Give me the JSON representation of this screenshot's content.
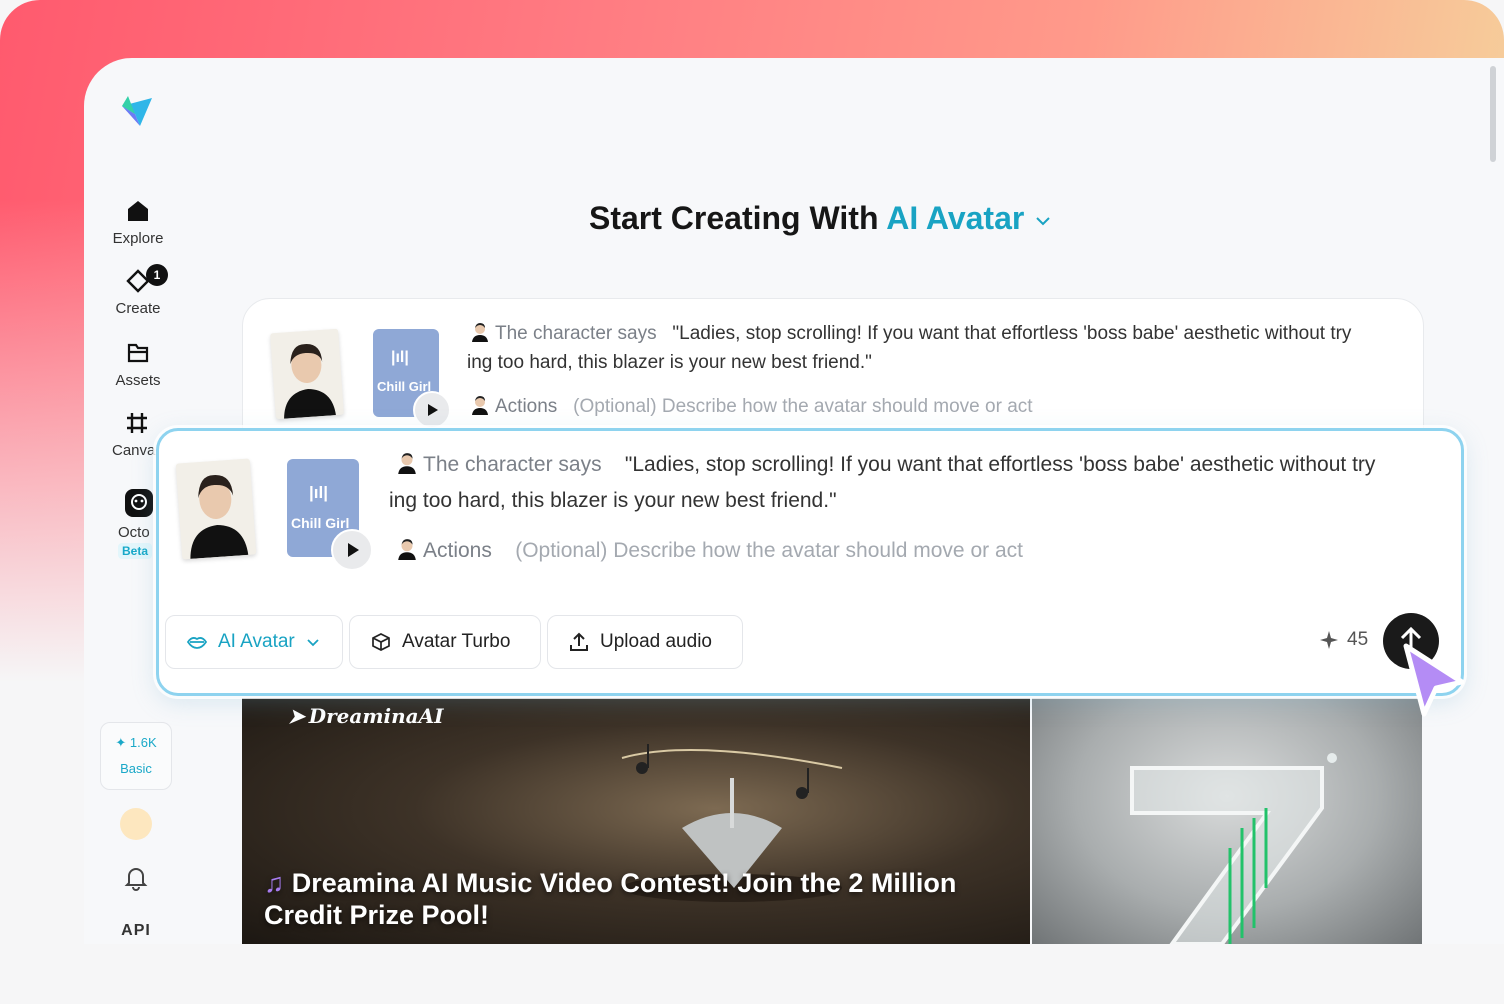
{
  "sidebar": {
    "items": [
      {
        "label": "Explore",
        "icon": "home-icon"
      },
      {
        "label": "Create",
        "icon": "create-icon",
        "badge": "1"
      },
      {
        "label": "Assets",
        "icon": "folder-icon"
      },
      {
        "label": "Canva",
        "icon": "canvas-icon"
      },
      {
        "label": "Octo",
        "icon": "octo-icon",
        "tag": "Beta"
      }
    ],
    "credits": {
      "amount": "1.6K",
      "plan": "Basic"
    },
    "api_label": "API"
  },
  "main": {
    "headline_prefix": "Start Creating With",
    "headline_accent": "AI Avatar",
    "prompt": {
      "says_label": "The character says",
      "line1": "\"Ladies, stop scrolling! If you want that effortless 'boss babe' aesthetic without try",
      "line2": "ing too hard, this blazer is your new best friend.\"",
      "actions_label": "Actions",
      "actions_placeholder": "(Optional) Describe how the avatar should move or act",
      "audio_name": "Chill Girl"
    },
    "toolbar": {
      "mode_label": "AI Avatar",
      "model_label": "Avatar Turbo",
      "upload_label": "Upload audio",
      "cost": "45"
    }
  },
  "banners": {
    "brand": "DreaminaAI",
    "title_line1": "Dreamina AI Music Video Contest! Join the 2 Million",
    "title_line2": "Credit Prize Pool!"
  },
  "colors": {
    "accent": "#19a3c3",
    "highlight_border": "#8ed3ef",
    "cursor": "#b48cf5"
  }
}
